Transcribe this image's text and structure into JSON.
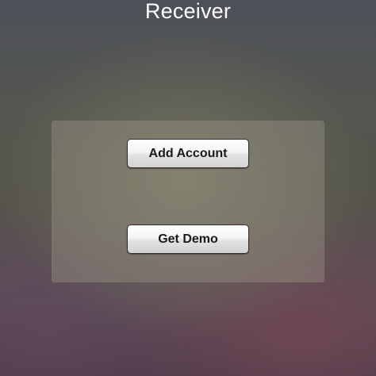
{
  "header": {
    "title": "Receiver"
  },
  "panel": {
    "add_account_label": "Add Account",
    "get_demo_label": "Get Demo"
  }
}
